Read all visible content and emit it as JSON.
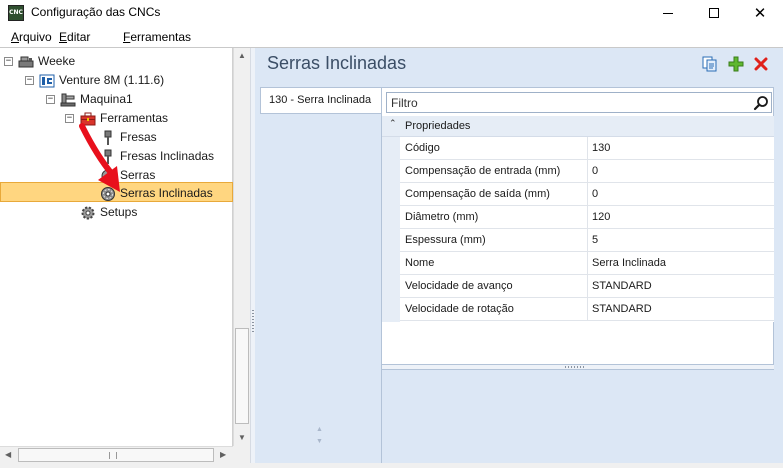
{
  "window": {
    "title": "Configuração das CNCs",
    "app_icon_text": "CNC"
  },
  "menu": {
    "items": [
      {
        "label": "Arquivo"
      },
      {
        "label": "Editar"
      },
      {
        "label": "Ferramentas"
      }
    ]
  },
  "tree": {
    "items": [
      {
        "label": "Weeke",
        "expander": "−",
        "icon": "machine-icon"
      },
      {
        "label": "Venture 8M (1.11.6)",
        "expander": "−",
        "icon": "cnc-icon"
      },
      {
        "label": "Maquina1",
        "expander": "−",
        "icon": "machine-unit-icon"
      },
      {
        "label": "Ferramentas",
        "expander": "−",
        "icon": "toolbox-icon"
      },
      {
        "label": "Fresas",
        "icon": "mill-icon"
      },
      {
        "label": "Fresas Inclinadas",
        "icon": "mill-icon"
      },
      {
        "label": "Serras",
        "icon": "saw-icon"
      },
      {
        "label": "Serras Inclinadas",
        "icon": "saw-icon",
        "selected": true
      },
      {
        "label": "Setups",
        "icon": "gear-icon"
      }
    ]
  },
  "content": {
    "title": "Serras Inclinadas",
    "toolbar": {
      "copy_icon": "copy-icon",
      "add_icon": "add-icon",
      "delete_icon": "delete-icon"
    },
    "tabs": [
      {
        "label": "130 - Serra Inclinada"
      }
    ],
    "filter": {
      "placeholder": "Filtro"
    },
    "category": {
      "label": "Propriedades"
    },
    "properties": [
      {
        "name": "Código",
        "value": "130"
      },
      {
        "name": "Compensação de entrada (mm)",
        "value": "0"
      },
      {
        "name": "Compensação de saída (mm)",
        "value": "0"
      },
      {
        "name": "Diâmetro (mm)",
        "value": "120"
      },
      {
        "name": "Espessura (mm)",
        "value": "5"
      },
      {
        "name": "Nome",
        "value": "Serra Inclinada"
      },
      {
        "name": "Velocidade de avanço",
        "value": "STANDARD"
      },
      {
        "name": "Velocidade de rotação",
        "value": "STANDARD"
      }
    ]
  },
  "colors": {
    "selection_fill": "#ffd680",
    "selection_border": "#e8a93a",
    "panel_background": "#dce7f5",
    "title_text": "#3b4e66",
    "annotation_arrow": "#e8101c"
  }
}
